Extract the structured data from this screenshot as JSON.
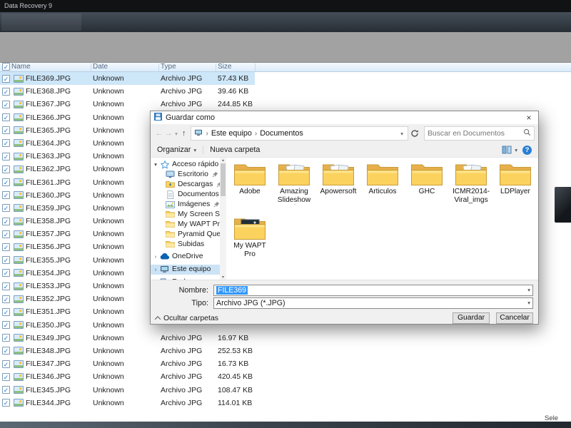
{
  "window": {
    "title": "Data Recovery 9",
    "status_right": "Sele"
  },
  "icons": {
    "back": "←",
    "forward": "→",
    "up": "↑",
    "dropdown": "▾",
    "breadcrumb_separator": "›",
    "collapsed": "›",
    "expanded": "▾",
    "check": "✓",
    "close": "×",
    "help": "?",
    "scroll_up": "▴",
    "scroll_down": "▾"
  },
  "table": {
    "header": {
      "name": "Name",
      "date": "Date",
      "type": "Type",
      "size": "Size"
    },
    "rows": [
      {
        "name": "FILE369.JPG",
        "date": "Unknown",
        "type": "Archivo JPG",
        "size": "57.43 KB",
        "checked": true,
        "selected": true
      },
      {
        "name": "FILE368.JPG",
        "date": "Unknown",
        "type": "Archivo JPG",
        "size": "39.46 KB",
        "checked": true
      },
      {
        "name": "FILE367.JPG",
        "date": "Unknown",
        "type": "Archivo JPG",
        "size": "244.85 KB",
        "checked": true
      },
      {
        "name": "FILE366.JPG",
        "date": "Unknown",
        "type": "",
        "size": "",
        "checked": true
      },
      {
        "name": "FILE365.JPG",
        "date": "Unknown",
        "type": "",
        "size": "",
        "checked": true
      },
      {
        "name": "FILE364.JPG",
        "date": "Unknown",
        "type": "",
        "size": "",
        "checked": true
      },
      {
        "name": "FILE363.JPG",
        "date": "Unknown",
        "type": "",
        "size": "",
        "checked": true
      },
      {
        "name": "FILE362.JPG",
        "date": "Unknown",
        "type": "",
        "size": "",
        "checked": true
      },
      {
        "name": "FILE361.JPG",
        "date": "Unknown",
        "type": "",
        "size": "",
        "checked": true
      },
      {
        "name": "FILE360.JPG",
        "date": "Unknown",
        "type": "",
        "size": "",
        "checked": true
      },
      {
        "name": "FILE359.JPG",
        "date": "Unknown",
        "type": "",
        "size": "",
        "checked": true
      },
      {
        "name": "FILE358.JPG",
        "date": "Unknown",
        "type": "",
        "size": "",
        "checked": true
      },
      {
        "name": "FILE357.JPG",
        "date": "Unknown",
        "type": "",
        "size": "",
        "checked": true
      },
      {
        "name": "FILE356.JPG",
        "date": "Unknown",
        "type": "",
        "size": "",
        "checked": true
      },
      {
        "name": "FILE355.JPG",
        "date": "Unknown",
        "type": "",
        "size": "",
        "checked": true
      },
      {
        "name": "FILE354.JPG",
        "date": "Unknown",
        "type": "",
        "size": "",
        "checked": true
      },
      {
        "name": "FILE353.JPG",
        "date": "Unknown",
        "type": "",
        "size": "",
        "checked": true
      },
      {
        "name": "FILE352.JPG",
        "date": "Unknown",
        "type": "",
        "size": "",
        "checked": true
      },
      {
        "name": "FILE351.JPG",
        "date": "Unknown",
        "type": "",
        "size": "",
        "checked": true
      },
      {
        "name": "FILE350.JPG",
        "date": "Unknown",
        "type": "",
        "size": "",
        "checked": true
      },
      {
        "name": "FILE349.JPG",
        "date": "Unknown",
        "type": "Archivo JPG",
        "size": "16.97 KB",
        "checked": true
      },
      {
        "name": "FILE348.JPG",
        "date": "Unknown",
        "type": "Archivo JPG",
        "size": "252.53 KB",
        "checked": true
      },
      {
        "name": "FILE347.JPG",
        "date": "Unknown",
        "type": "Archivo JPG",
        "size": "16.73 KB",
        "checked": true
      },
      {
        "name": "FILE346.JPG",
        "date": "Unknown",
        "type": "Archivo JPG",
        "size": "420.45 KB",
        "checked": true
      },
      {
        "name": "FILE345.JPG",
        "date": "Unknown",
        "type": "Archivo JPG",
        "size": "108.47 KB",
        "checked": true
      },
      {
        "name": "FILE344.JPG",
        "date": "Unknown",
        "type": "Archivo JPG",
        "size": "114.01 KB",
        "checked": true
      }
    ]
  },
  "dialog": {
    "title": "Guardar como",
    "breadcrumb": [
      "Este equipo",
      "Documentos"
    ],
    "search_placeholder": "Buscar en Documentos",
    "toolbar": {
      "organize": "Organizar",
      "new_folder": "Nueva carpeta"
    },
    "sidebar": [
      {
        "label": "Acceso rápido",
        "icon": "star",
        "level": 0,
        "expander": "expanded"
      },
      {
        "label": "Escritorio",
        "icon": "desktop",
        "level": 1,
        "pinned": true
      },
      {
        "label": "Descargas",
        "icon": "downloads",
        "level": 1,
        "pinned": true
      },
      {
        "label": "Documentos",
        "icon": "document",
        "level": 1,
        "pinned": true
      },
      {
        "label": "Imágenes",
        "icon": "pictures",
        "level": 1,
        "pinned": true
      },
      {
        "label": "My Screen Shots",
        "icon": "folder",
        "level": 1
      },
      {
        "label": "My WAPT Pro",
        "icon": "folder",
        "level": 1
      },
      {
        "label": "Pyramid Quest",
        "icon": "folder",
        "level": 1
      },
      {
        "label": "Subidas",
        "icon": "folder",
        "level": 1
      },
      {
        "label": "OneDrive",
        "icon": "cloud",
        "level": 0,
        "expander": "collapsed"
      },
      {
        "label": "Este equipo",
        "icon": "computer",
        "level": 0,
        "expander": "collapsed",
        "selected": true
      },
      {
        "label": "Red",
        "icon": "network",
        "level": 0,
        "expander": "collapsed"
      }
    ],
    "folders": [
      {
        "name": "Adobe",
        "preview": "none"
      },
      {
        "name": "Amazing Slideshow Maker",
        "preview": "docs"
      },
      {
        "name": "Apowersoft",
        "preview": "docs"
      },
      {
        "name": "Articulos",
        "preview": "none"
      },
      {
        "name": "GHC",
        "preview": "none"
      },
      {
        "name": "ICMR2014-Viral_imgs",
        "preview": "docs"
      },
      {
        "name": "LDPlayer",
        "preview": "none"
      },
      {
        "name": "My WAPT Pro",
        "preview": "image"
      }
    ],
    "filename": {
      "label": "Nombre:",
      "value": "FILE369"
    },
    "filetype": {
      "label": "Tipo:",
      "value": "Archivo JPG (*.JPG)"
    },
    "hide_folders": "Ocultar carpetas",
    "buttons": {
      "save": "Guardar",
      "cancel": "Cancelar"
    }
  }
}
